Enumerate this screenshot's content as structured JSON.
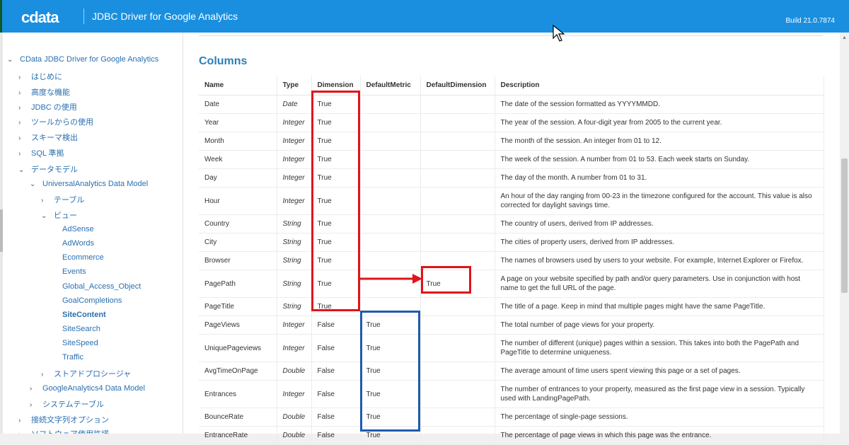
{
  "header": {
    "logo": "cdata",
    "title": "JDBC Driver for Google Analytics",
    "build": "Build 21.0.7874"
  },
  "sidebar": {
    "items": [
      {
        "label": "CData JDBC Driver for Google Analytics",
        "chev": "v"
      },
      {
        "label": "はじめに",
        "chev": ">"
      },
      {
        "label": "高度な機能",
        "chev": ">"
      },
      {
        "label": "JDBC の使用",
        "chev": ">"
      },
      {
        "label": "ツールからの使用",
        "chev": ">"
      },
      {
        "label": "スキーマ検出",
        "chev": ">"
      },
      {
        "label": "SQL 準拠",
        "chev": ">"
      },
      {
        "label": "データモデル",
        "chev": "v"
      },
      {
        "label": "UniversalAnalytics Data Model",
        "chev": "v"
      },
      {
        "label": "テーブル",
        "chev": ">"
      },
      {
        "label": "ビュー",
        "chev": "v"
      },
      {
        "label": "AdSense",
        "chev": ""
      },
      {
        "label": "AdWords",
        "chev": ""
      },
      {
        "label": "Ecommerce",
        "chev": ""
      },
      {
        "label": "Events",
        "chev": ""
      },
      {
        "label": "Global_Access_Object",
        "chev": ""
      },
      {
        "label": "GoalCompletions",
        "chev": ""
      },
      {
        "label": "SiteContent",
        "chev": ""
      },
      {
        "label": "SiteSearch",
        "chev": ""
      },
      {
        "label": "SiteSpeed",
        "chev": ""
      },
      {
        "label": "Traffic",
        "chev": ""
      },
      {
        "label": "ストアドプロシージャ",
        "chev": ">"
      },
      {
        "label": "GoogleAnalytics4 Data Model",
        "chev": ">"
      },
      {
        "label": "システムテーブル",
        "chev": ">"
      },
      {
        "label": "接続文字列オプション",
        "chev": ">"
      },
      {
        "label": "ソフトウェア使用許諾",
        "chev": ">"
      }
    ]
  },
  "main": {
    "heading": "Columns",
    "columns": [
      "Name",
      "Type",
      "Dimension",
      "DefaultMetric",
      "DefaultDimension",
      "Description"
    ],
    "rows": [
      {
        "name": "Date",
        "type": "Date",
        "dim": "True",
        "dm": "",
        "dd": "",
        "desc": "The date of the session formatted as YYYYMMDD."
      },
      {
        "name": "Year",
        "type": "Integer",
        "dim": "True",
        "dm": "",
        "dd": "",
        "desc": "The year of the session. A four-digit year from 2005 to the current year."
      },
      {
        "name": "Month",
        "type": "Integer",
        "dim": "True",
        "dm": "",
        "dd": "",
        "desc": "The month of the session. An integer from 01 to 12."
      },
      {
        "name": "Week",
        "type": "Integer",
        "dim": "True",
        "dm": "",
        "dd": "",
        "desc": "The week of the session. A number from 01 to 53. Each week starts on Sunday."
      },
      {
        "name": "Day",
        "type": "Integer",
        "dim": "True",
        "dm": "",
        "dd": "",
        "desc": "The day of the month. A number from 01 to 31."
      },
      {
        "name": "Hour",
        "type": "Integer",
        "dim": "True",
        "dm": "",
        "dd": "",
        "desc": "An hour of the day ranging from 00-23 in the timezone configured for the account. This value is also corrected for daylight savings time."
      },
      {
        "name": "Country",
        "type": "String",
        "dim": "True",
        "dm": "",
        "dd": "",
        "desc": "The country of users, derived from IP addresses."
      },
      {
        "name": "City",
        "type": "String",
        "dim": "True",
        "dm": "",
        "dd": "",
        "desc": "The cities of property users, derived from IP addresses."
      },
      {
        "name": "Browser",
        "type": "String",
        "dim": "True",
        "dm": "",
        "dd": "",
        "desc": "The names of browsers used by users to your website. For example, Internet Explorer or Firefox."
      },
      {
        "name": "PagePath",
        "type": "String",
        "dim": "True",
        "dm": "",
        "dd": "True",
        "desc": "A page on your website specified by path and/or query parameters. Use in conjunction with host name to get the full URL of the page."
      },
      {
        "name": "PageTitle",
        "type": "String",
        "dim": "True",
        "dm": "",
        "dd": "",
        "desc": "The title of a page. Keep in mind that multiple pages might have the same PageTitle."
      },
      {
        "name": "PageViews",
        "type": "Integer",
        "dim": "False",
        "dm": "True",
        "dd": "",
        "desc": "The total number of page views for your property."
      },
      {
        "name": "UniquePageviews",
        "type": "Integer",
        "dim": "False",
        "dm": "True",
        "dd": "",
        "desc": "The number of different (unique) pages within a session. This takes into both the PagePath and PageTitle to determine uniqueness."
      },
      {
        "name": "AvgTimeOnPage",
        "type": "Double",
        "dim": "False",
        "dm": "True",
        "dd": "",
        "desc": "The average amount of time users spent viewing this page or a set of pages."
      },
      {
        "name": "Entrances",
        "type": "Integer",
        "dim": "False",
        "dm": "True",
        "dd": "",
        "desc": "The number of entrances to your property, measured as the first page view in a session. Typically used with LandingPagePath."
      },
      {
        "name": "BounceRate",
        "type": "Double",
        "dim": "False",
        "dm": "True",
        "dd": "",
        "desc": "The percentage of single-page sessions."
      },
      {
        "name": "EntranceRate",
        "type": "Double",
        "dim": "False",
        "dm": "True",
        "dd": "",
        "desc": "The percentage of page views in which this page was the entrance."
      }
    ]
  },
  "annotations": {
    "callout_text": "True",
    "red": "#e0141a",
    "blue": "#1e5bb0"
  }
}
